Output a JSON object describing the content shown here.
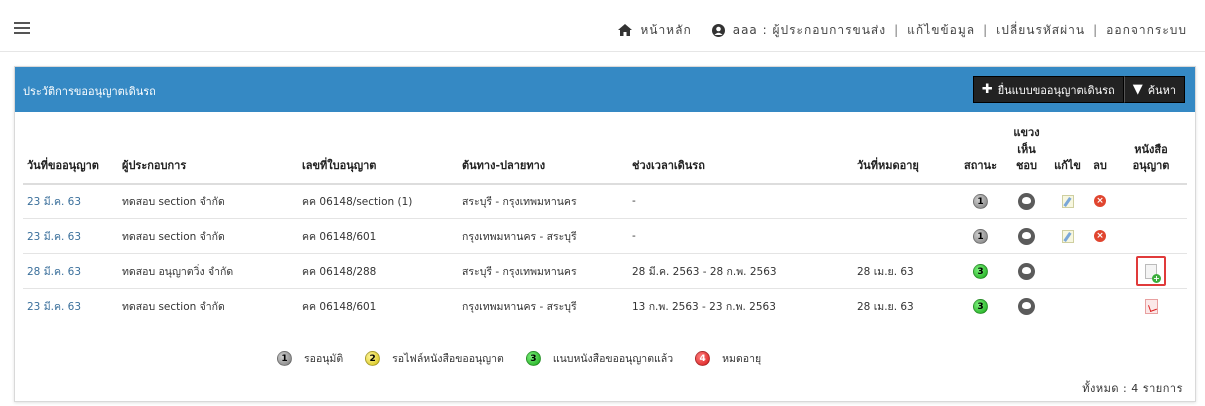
{
  "topnav": {
    "home": "หน้าหลัก",
    "user": "aaa : ผู้ประกอบการขนส่ง",
    "edit_profile": "แก้ไขข้อมูล",
    "change_password": "เปลี่ยนรหัสผ่าน",
    "logout": "ออกจากระบบ",
    "separator": "|"
  },
  "panel": {
    "title": "ประวัติการขออนุญาตเดินรถ",
    "new_button": "ยื่นแบบขออนุญาตเดินรถ",
    "search_button": "ค้นหา"
  },
  "table": {
    "headers": {
      "date": "วันที่ขออนุญาต",
      "operator": "ผู้ประกอบการ",
      "license": "เลขที่ใบอนุญาต",
      "route": "ต้นทาง-ปลายทาง",
      "period": "ช่วงเวลาเดินรถ",
      "expire": "วันที่หมดอายุ",
      "status": "สถานะ",
      "comment_1": "แขวง",
      "comment_2": "เห็นชอบ",
      "edit": "แก้ไข",
      "delete": "ลบ",
      "doc_1": "หนังสือ",
      "doc_2": "อนุญาต"
    },
    "rows": [
      {
        "date": "23 มี.ค. 63",
        "operator": "ทดสอบ section จำกัด",
        "license": "คค 06148/section (1)",
        "route": "สระบุรี - กรุงเทพมหานคร",
        "period": "-",
        "expire": "",
        "status": "1",
        "status_color": "gray",
        "editable": true,
        "deletable": true,
        "doc": "none"
      },
      {
        "date": "23 มี.ค. 63",
        "operator": "ทดสอบ section จำกัด",
        "license": "คค 06148/601",
        "route": "กรุงเทพมหานคร - สระบุรี",
        "period": "-",
        "expire": "",
        "status": "1",
        "status_color": "gray",
        "editable": true,
        "deletable": true,
        "doc": "none"
      },
      {
        "date": "28 มี.ค. 63",
        "operator": "ทดสอบ อนุญาตวิ่ง จำกัด",
        "license": "คค 06148/288",
        "route": "สระบุรี - กรุงเทพมหานคร",
        "period": "28 มี.ค. 2563 - 28 ก.พ. 2563",
        "expire": "28 เม.ย. 63",
        "status": "3",
        "status_color": "green",
        "editable": false,
        "deletable": false,
        "doc": "add"
      },
      {
        "date": "23 มี.ค. 63",
        "operator": "ทดสอบ section จำกัด",
        "license": "คค 06148/601",
        "route": "กรุงเทพมหานคร - สระบุรี",
        "period": "13 ก.พ. 2563 - 23 ก.พ. 2563",
        "expire": "28 เม.ย. 63",
        "status": "3",
        "status_color": "green",
        "editable": false,
        "deletable": false,
        "doc": "pdf"
      }
    ]
  },
  "legend": [
    {
      "num": "1",
      "label": "รออนุมัติ",
      "color": "gray"
    },
    {
      "num": "2",
      "label": "รอไฟล์หนังสือขออนุญาต",
      "color": "yellow"
    },
    {
      "num": "3",
      "label": "แนบหนังสือขออนุญาตแล้ว",
      "color": "green"
    },
    {
      "num": "4",
      "label": "หมดอายุ",
      "color": "red"
    }
  ],
  "total": "ทั้งหมด : 4 รายการ",
  "colors": {
    "header_blue": "#3589c4",
    "button_black": "#222222",
    "link_blue": "#3a6f9b",
    "highlight_red": "#e03a3a"
  }
}
